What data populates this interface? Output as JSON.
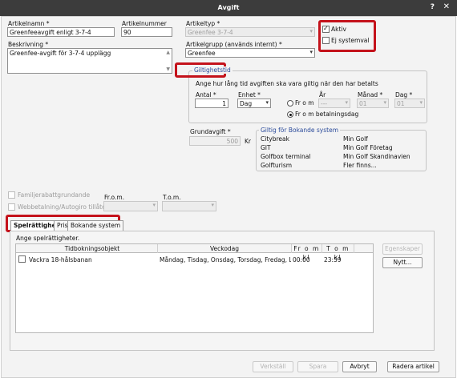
{
  "window": {
    "title": "Avgift",
    "help": "?",
    "close": "✕"
  },
  "artikel": {
    "namn_label": "Artikelnamn *",
    "namn_value": "Greenfeeavgift enligt 3-7-4",
    "nummer_label": "Artikelnummer",
    "nummer_value": "90",
    "beskrivning_label": "Beskrivning *",
    "beskrivning_value": "Greenfee-avgift för 3-7-4 upplägg",
    "typ_label": "Artikeltyp *",
    "typ_value": "Greenfee 3-7-4",
    "grupp_label": "Artikelgrupp (används internt) *",
    "grupp_value": "Greenfee"
  },
  "flags": {
    "aktiv_label": "Aktiv",
    "aktiv_checked": true,
    "ej_label": "Ej systemval",
    "ej_checked": false
  },
  "giltighet": {
    "tab": "Giltighetstid",
    "intro": "Ange hur lång tid avgiften ska vara giltig när den har betalts",
    "antal_label": "Antal *",
    "antal_value": "1",
    "enhet_label": "Enhet *",
    "enhet_value": "Dag",
    "ar_label": "År",
    "ar_value": "---",
    "manad_label": "Månad *",
    "manad_value": "01",
    "dag_label": "Dag *",
    "dag_value": "01",
    "from_label": "Fr o m",
    "from_bet_label": "Fr o m betalningsdag"
  },
  "grund": {
    "label": "Grundavgift *",
    "value": "500",
    "unit": "Kr"
  },
  "bokande": {
    "title": "Giltig för Bokande system",
    "items": [
      "Citybreak",
      "GIT",
      "Golfbox terminal",
      "Golfturism",
      "Min Golf",
      "Min Golf Företag",
      "Min Golf Skandinavien",
      "Fler finns..."
    ]
  },
  "familj": {
    "label": "Familjerabattgrundande"
  },
  "webb": {
    "label": "Webbetalning/Autogiro tillåten"
  },
  "from_tom": {
    "from_label": "Fr.o.m.",
    "tom_label": "T.o.m."
  },
  "tabs": [
    {
      "label": "Spelrättighet"
    },
    {
      "label": "Pris"
    },
    {
      "label": "Bokande system"
    }
  ],
  "spel": {
    "intro": "Ange spelrättigheter.",
    "columns": [
      "Tidbokningsobjekt",
      "Veckodag",
      "Fr o m kl",
      "T o m kl"
    ],
    "rows": [
      {
        "objekt": "Vackra 18-hålsbanan",
        "veckodag": "Måndag, Tisdag, Onsdag, Torsdag, Fredag, Lörda",
        "from": "00:00",
        "tom": "23:59"
      }
    ],
    "egenskaper": "Egenskaper",
    "nytt": "Nytt..."
  },
  "footer": {
    "verkstall": "Verkställ",
    "spara": "Spara",
    "avbryt": "Avbryt",
    "radera": "Radera artikel"
  }
}
